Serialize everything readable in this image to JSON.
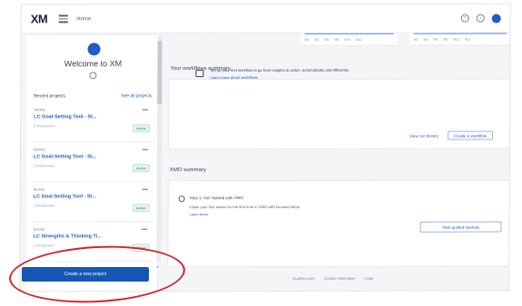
{
  "topbar": {
    "logo": "XM",
    "breadcrumb": "Home",
    "help_icon": "help-icon",
    "notif_icon": "bell-icon"
  },
  "left": {
    "welcome": "Welcome to XM",
    "recent_label": "Recent projects",
    "see_all": "See all projects",
    "projects": [
      {
        "type": "Survey",
        "name": "LC Goal-Setting Tool - St...",
        "sub": "3 Responses",
        "status": "Active"
      },
      {
        "type": "Survey",
        "name": "LC Goal-Setting Tool - St...",
        "sub": "5 Responses",
        "status": "Active"
      },
      {
        "type": "Survey",
        "name": "LC Goal-Setting Tool - St...",
        "sub": "3 Responses",
        "status": "Active"
      },
      {
        "type": "Survey",
        "name": "LC Strengths & Thinking Ti...",
        "sub": "3 Responses",
        "status": "Active"
      },
      {
        "type": "Survey",
        "name": "",
        "sub": "",
        "status": ""
      }
    ],
    "create_button": "Create a new project"
  },
  "main": {
    "chart_ticks": [
      "M2",
      "M4",
      "M6",
      "M8",
      "M10",
      "M12",
      "M14"
    ],
    "workflow_title": "Your workflows summary",
    "workflow_text": "Set up your first workflow to go from insights to action, automatically and efficiently.",
    "workflow_link": "Learn more about workflows",
    "view_history": "View run history",
    "create_workflow": "Create a workflow",
    "xmo_title": "XMO summary",
    "xmo_step": "Step 1: Get Started with XMO",
    "xmo_sub": "Claim your first metric for the first time in XMO with focused steps",
    "xmo_link": "Learn more",
    "get_started": "Start guided tutorials"
  },
  "footer": {
    "items": [
      "Qualtrics.com",
      "Contact information",
      "Legal"
    ]
  }
}
